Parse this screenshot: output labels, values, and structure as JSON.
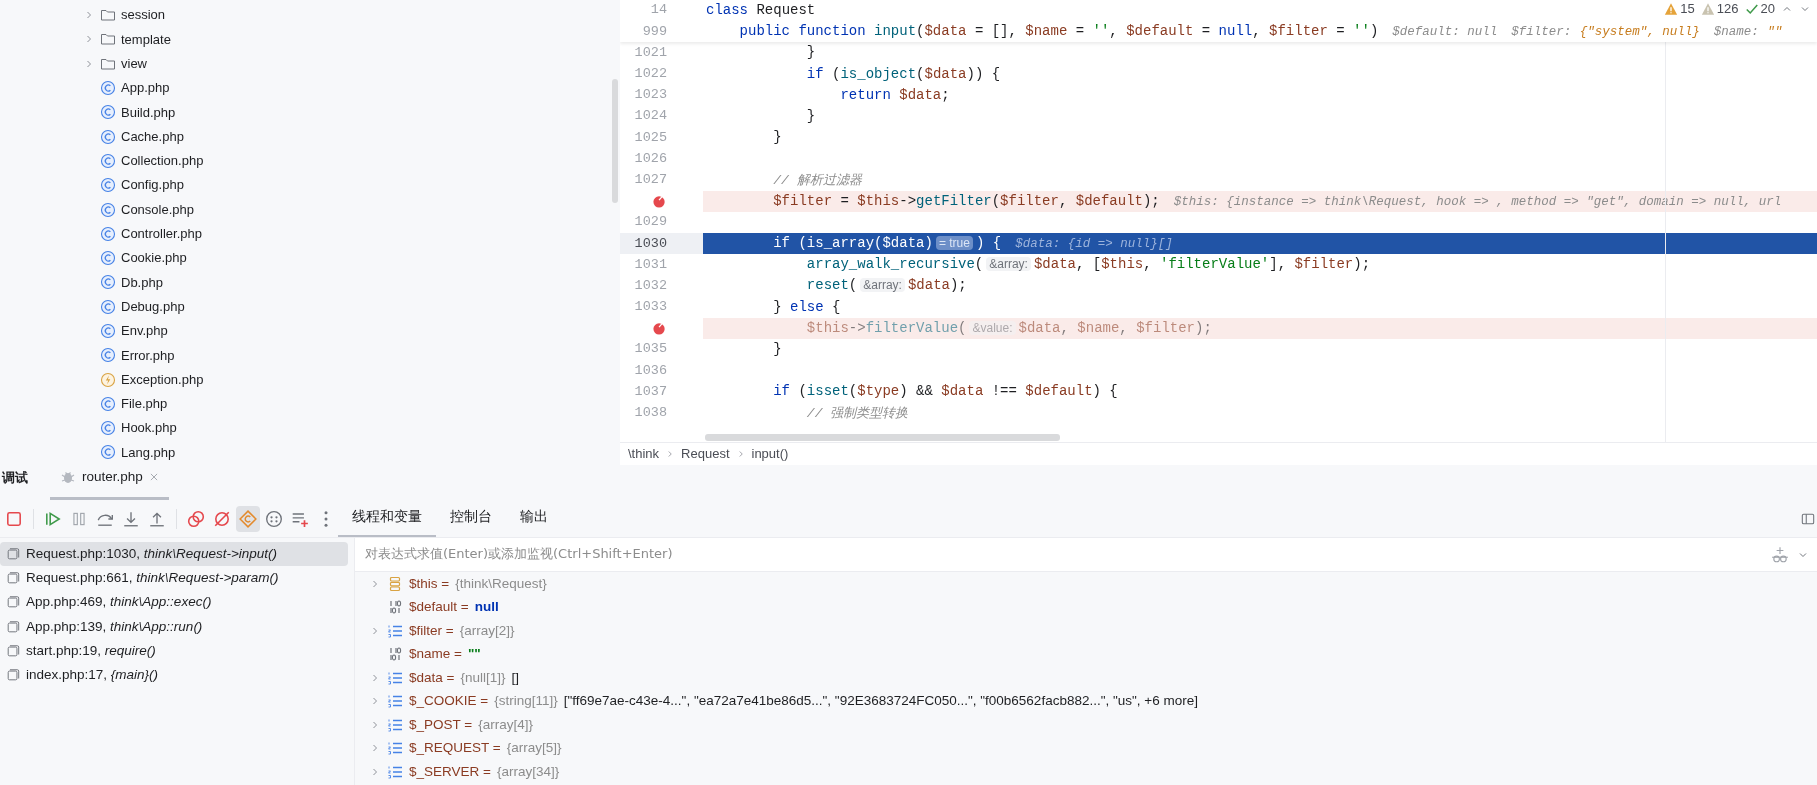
{
  "project_tree": [
    {
      "label": "session",
      "kind": "folder",
      "expandable": true
    },
    {
      "label": "template",
      "kind": "folder",
      "expandable": true
    },
    {
      "label": "view",
      "kind": "folder",
      "expandable": true
    },
    {
      "label": "App.php",
      "kind": "class",
      "expandable": false
    },
    {
      "label": "Build.php",
      "kind": "class",
      "expandable": false
    },
    {
      "label": "Cache.php",
      "kind": "class",
      "expandable": false
    },
    {
      "label": "Collection.php",
      "kind": "class",
      "expandable": false
    },
    {
      "label": "Config.php",
      "kind": "class",
      "expandable": false
    },
    {
      "label": "Console.php",
      "kind": "class",
      "expandable": false
    },
    {
      "label": "Controller.php",
      "kind": "class",
      "expandable": false
    },
    {
      "label": "Cookie.php",
      "kind": "class",
      "expandable": false
    },
    {
      "label": "Db.php",
      "kind": "class",
      "expandable": false
    },
    {
      "label": "Debug.php",
      "kind": "class",
      "expandable": false
    },
    {
      "label": "Env.php",
      "kind": "class",
      "expandable": false
    },
    {
      "label": "Error.php",
      "kind": "class",
      "expandable": false
    },
    {
      "label": "Exception.php",
      "kind": "exception",
      "expandable": false
    },
    {
      "label": "File.php",
      "kind": "class",
      "expandable": false
    },
    {
      "label": "Hook.php",
      "kind": "class",
      "expandable": false
    },
    {
      "label": "Lang.php",
      "kind": "class",
      "expandable": false
    }
  ],
  "editor": {
    "inspections": [
      {
        "kind": "error",
        "count": "15"
      },
      {
        "kind": "warning",
        "count": "126"
      },
      {
        "kind": "ok",
        "count": "20"
      }
    ],
    "sticky_lines": [
      {
        "number": "14",
        "segments": [
          {
            "kind": "kw",
            "text": "class"
          },
          {
            "kind": "plain",
            "text": " Request"
          }
        ]
      },
      {
        "number": "999",
        "segments": [
          {
            "kind": "kw",
            "text": "    public function"
          },
          {
            "kind": "fn",
            "text": " input"
          },
          {
            "kind": "plain",
            "text": "("
          },
          {
            "kind": "var",
            "text": "$data"
          },
          {
            "kind": "plain",
            "text": " = [], "
          },
          {
            "kind": "var",
            "text": "$name"
          },
          {
            "kind": "plain",
            "text": " = "
          },
          {
            "kind": "str",
            "text": "''"
          },
          {
            "kind": "plain",
            "text": ", "
          },
          {
            "kind": "var",
            "text": "$default"
          },
          {
            "kind": "plain",
            "text": " = "
          },
          {
            "kind": "kw",
            "text": "null"
          },
          {
            "kind": "plain",
            "text": ", "
          },
          {
            "kind": "var",
            "text": "$filter"
          },
          {
            "kind": "plain",
            "text": " = "
          },
          {
            "kind": "str",
            "text": "''"
          },
          {
            "kind": "plain",
            "text": ")"
          },
          {
            "kind": "hint",
            "text": "$default: null"
          },
          {
            "kind": "hint",
            "text": "$filter: "
          },
          {
            "kind": "hintstr",
            "text": "{\"system\", null}"
          },
          {
            "kind": "hint",
            "text": "$name: "
          },
          {
            "kind": "hintstr",
            "text": "\"\""
          }
        ]
      }
    ],
    "lines": [
      {
        "number": "1021",
        "breakpoint": false,
        "current": false,
        "dimmed": false,
        "segments": [
          {
            "kind": "plain",
            "text": "            }"
          }
        ]
      },
      {
        "number": "1022",
        "breakpoint": false,
        "current": false,
        "dimmed": false,
        "segments": [
          {
            "kind": "kw",
            "text": "            if"
          },
          {
            "kind": "plain",
            "text": " ("
          },
          {
            "kind": "fn",
            "text": "is_object"
          },
          {
            "kind": "plain",
            "text": "("
          },
          {
            "kind": "var",
            "text": "$data"
          },
          {
            "kind": "plain",
            "text": ")) {"
          }
        ]
      },
      {
        "number": "1023",
        "breakpoint": false,
        "current": false,
        "dimmed": false,
        "segments": [
          {
            "kind": "kw",
            "text": "                return"
          },
          {
            "kind": "var",
            "text": " $data"
          },
          {
            "kind": "plain",
            "text": ";"
          }
        ]
      },
      {
        "number": "1024",
        "breakpoint": false,
        "current": false,
        "dimmed": false,
        "segments": [
          {
            "kind": "plain",
            "text": "            }"
          }
        ]
      },
      {
        "number": "1025",
        "breakpoint": false,
        "current": false,
        "dimmed": false,
        "segments": [
          {
            "kind": "plain",
            "text": "        }"
          }
        ]
      },
      {
        "number": "1026",
        "breakpoint": false,
        "current": false
      },
      {
        "number": "1027",
        "breakpoint": false,
        "current": false,
        "dimmed": false,
        "segments": [
          {
            "kind": "comment",
            "text": "        // 解析过滤器"
          }
        ]
      },
      {
        "breakpoint": true,
        "current": false,
        "dimmed": false,
        "segments": [
          {
            "kind": "var",
            "text": "        $filter"
          },
          {
            "kind": "plain",
            "text": " = "
          },
          {
            "kind": "var",
            "text": "$this"
          },
          {
            "kind": "plain",
            "text": "->"
          },
          {
            "kind": "fn",
            "text": "getFilter"
          },
          {
            "kind": "plain",
            "text": "("
          },
          {
            "kind": "var",
            "text": "$filter"
          },
          {
            "kind": "plain",
            "text": ", "
          },
          {
            "kind": "var",
            "text": "$default"
          },
          {
            "kind": "plain",
            "text": ");"
          },
          {
            "kind": "hint",
            "text": "$this: {instance => think\\Request, hook => , method => \"get\", domain => null, url"
          }
        ]
      },
      {
        "number": "1029",
        "breakpoint": false,
        "current": false
      },
      {
        "number": "1030",
        "breakpoint": false,
        "current": true,
        "dimmed": false,
        "segments": [
          {
            "kind": "kw",
            "text": "        if"
          },
          {
            "kind": "plain",
            "text": " ("
          },
          {
            "kind": "fn",
            "text": "is_array"
          },
          {
            "kind": "plain",
            "text": "("
          },
          {
            "kind": "var",
            "text": "$data"
          },
          {
            "kind": "plain",
            "text": ")"
          },
          {
            "kind": "inlay",
            "text": "= true"
          },
          {
            "kind": "plain",
            "text": ") {"
          },
          {
            "kind": "hint",
            "text": "$data: {id => null}[]"
          }
        ]
      },
      {
        "number": "1031",
        "breakpoint": false,
        "current": false,
        "dimmed": false,
        "segments": [
          {
            "kind": "fn",
            "text": "            array_walk_recursive"
          },
          {
            "kind": "plain",
            "text": "("
          },
          {
            "kind": "inlay",
            "text": "&array:"
          },
          {
            "kind": "var",
            "text": "$data"
          },
          {
            "kind": "plain",
            "text": ", ["
          },
          {
            "kind": "var",
            "text": "$this"
          },
          {
            "kind": "plain",
            "text": ", "
          },
          {
            "kind": "str",
            "text": "'filterValue'"
          },
          {
            "kind": "plain",
            "text": "], "
          },
          {
            "kind": "var",
            "text": "$filter"
          },
          {
            "kind": "plain",
            "text": ");"
          }
        ]
      },
      {
        "number": "1032",
        "breakpoint": false,
        "current": false,
        "dimmed": false,
        "segments": [
          {
            "kind": "fn",
            "text": "            reset"
          },
          {
            "kind": "plain",
            "text": "("
          },
          {
            "kind": "inlay",
            "text": "&array:"
          },
          {
            "kind": "var",
            "text": "$data"
          },
          {
            "kind": "plain",
            "text": ");"
          }
        ]
      },
      {
        "number": "1033",
        "breakpoint": false,
        "current": false,
        "dimmed": false,
        "segments": [
          {
            "kind": "plain",
            "text": "        } "
          },
          {
            "kind": "kw",
            "text": "else"
          },
          {
            "kind": "plain",
            "text": " {"
          }
        ]
      },
      {
        "breakpoint": true,
        "current": false,
        "dimmed": true,
        "segments": [
          {
            "kind": "var",
            "text": "            $this"
          },
          {
            "kind": "plain",
            "text": "->"
          },
          {
            "kind": "fn",
            "text": "filterValue"
          },
          {
            "kind": "plain",
            "text": "("
          },
          {
            "kind": "inlay",
            "text": "&value:"
          },
          {
            "kind": "var",
            "text": "$data"
          },
          {
            "kind": "plain",
            "text": ", "
          },
          {
            "kind": "var",
            "text": "$name"
          },
          {
            "kind": "plain",
            "text": ", "
          },
          {
            "kind": "var",
            "text": "$filter"
          },
          {
            "kind": "plain",
            "text": ");"
          }
        ]
      },
      {
        "number": "1035",
        "breakpoint": false,
        "current": false,
        "dimmed": false,
        "segments": [
          {
            "kind": "plain",
            "text": "        }"
          }
        ]
      },
      {
        "number": "1036",
        "breakpoint": false,
        "current": false
      },
      {
        "number": "1037",
        "breakpoint": false,
        "current": false,
        "dimmed": false,
        "segments": [
          {
            "kind": "kw",
            "text": "        if"
          },
          {
            "kind": "plain",
            "text": " ("
          },
          {
            "kind": "fn",
            "text": "isset"
          },
          {
            "kind": "plain",
            "text": "("
          },
          {
            "kind": "var",
            "text": "$type"
          },
          {
            "kind": "plain",
            "text": ") && "
          },
          {
            "kind": "var",
            "text": "$data"
          },
          {
            "kind": "plain",
            "text": " !== "
          },
          {
            "kind": "var",
            "text": "$default"
          },
          {
            "kind": "plain",
            "text": ") {"
          }
        ]
      },
      {
        "number": "1038",
        "breakpoint": false,
        "current": false,
        "dimmed": false,
        "segments": [
          {
            "kind": "comment",
            "text": "            // 强制类型转换"
          }
        ]
      }
    ],
    "breadcrumbs": [
      "\\think",
      "Request",
      "input()"
    ]
  },
  "debug": {
    "title": "调试",
    "session_tabs": [
      {
        "label": "router.php",
        "selected": true
      }
    ],
    "toolbar": [
      [
        {
          "kind": "stop",
          "selected": false
        }
      ],
      [
        {
          "kind": "resume",
          "selected": false
        },
        {
          "kind": "pause",
          "selected": false
        },
        {
          "kind": "step-over",
          "selected": false
        },
        {
          "kind": "step-into",
          "selected": false
        },
        {
          "kind": "step-out",
          "selected": false
        }
      ],
      [
        {
          "kind": "breakpoints",
          "selected": false
        },
        {
          "kind": "mute",
          "selected": false
        },
        {
          "kind": "class-filter",
          "selected": true
        },
        {
          "kind": "dots",
          "selected": false
        },
        {
          "kind": "add-list",
          "selected": false
        },
        {
          "kind": "more",
          "selected": false
        }
      ]
    ],
    "view_tabs": [
      {
        "label": "线程和变量",
        "selected": true
      },
      {
        "label": "控制台",
        "selected": false
      },
      {
        "label": "输出",
        "selected": false
      }
    ],
    "frames": [
      {
        "file": "Request.php:1030, ",
        "method": "think\\Request->input()",
        "selected": true
      },
      {
        "file": "Request.php:661, ",
        "method": "think\\Request->param()",
        "selected": false
      },
      {
        "file": "App.php:469, ",
        "method": "think\\App::exec()",
        "selected": false
      },
      {
        "file": "App.php:139, ",
        "method": "think\\App::run()",
        "selected": false
      },
      {
        "file": "start.php:19, ",
        "method": "require()",
        "selected": false
      },
      {
        "file": "index.php:17, ",
        "method": "{main}()",
        "selected": false
      }
    ],
    "evaluate": {
      "placeholder": "对表达式求值(Enter)或添加监视(Ctrl+Shift+Enter)"
    },
    "variables": [
      {
        "expandable": true,
        "kind": "object",
        "name": "$this =",
        "type": "{think\\Request}"
      },
      {
        "expandable": false,
        "kind": "scalar",
        "name": "$default =",
        "value": "null",
        "color": "#0033b3"
      },
      {
        "expandable": true,
        "kind": "array",
        "name": "$filter =",
        "type": "{array[2]}"
      },
      {
        "expandable": false,
        "kind": "scalar",
        "name": "$name =",
        "value": "\"\"",
        "color": "#067d17"
      },
      {
        "expandable": true,
        "kind": "array",
        "name": "$data =",
        "type": "{null[1]}",
        "value": "[]"
      },
      {
        "expandable": true,
        "kind": "array",
        "name": "$_COOKIE =",
        "type": "{string[11]}",
        "value": "[\"ff69e7ae-c43e-4...\", \"ea72a7e41be86d5...\", \"92E3683724FC050...\", \"f00b6562facb882...\", \"us\", +6 more]"
      },
      {
        "expandable": true,
        "kind": "array",
        "name": "$_POST =",
        "type": "{array[4]}"
      },
      {
        "expandable": true,
        "kind": "array",
        "name": "$_REQUEST =",
        "type": "{array[5]}"
      },
      {
        "expandable": true,
        "kind": "array",
        "name": "$_SERVER =",
        "type": "{array[34]}"
      }
    ]
  }
}
